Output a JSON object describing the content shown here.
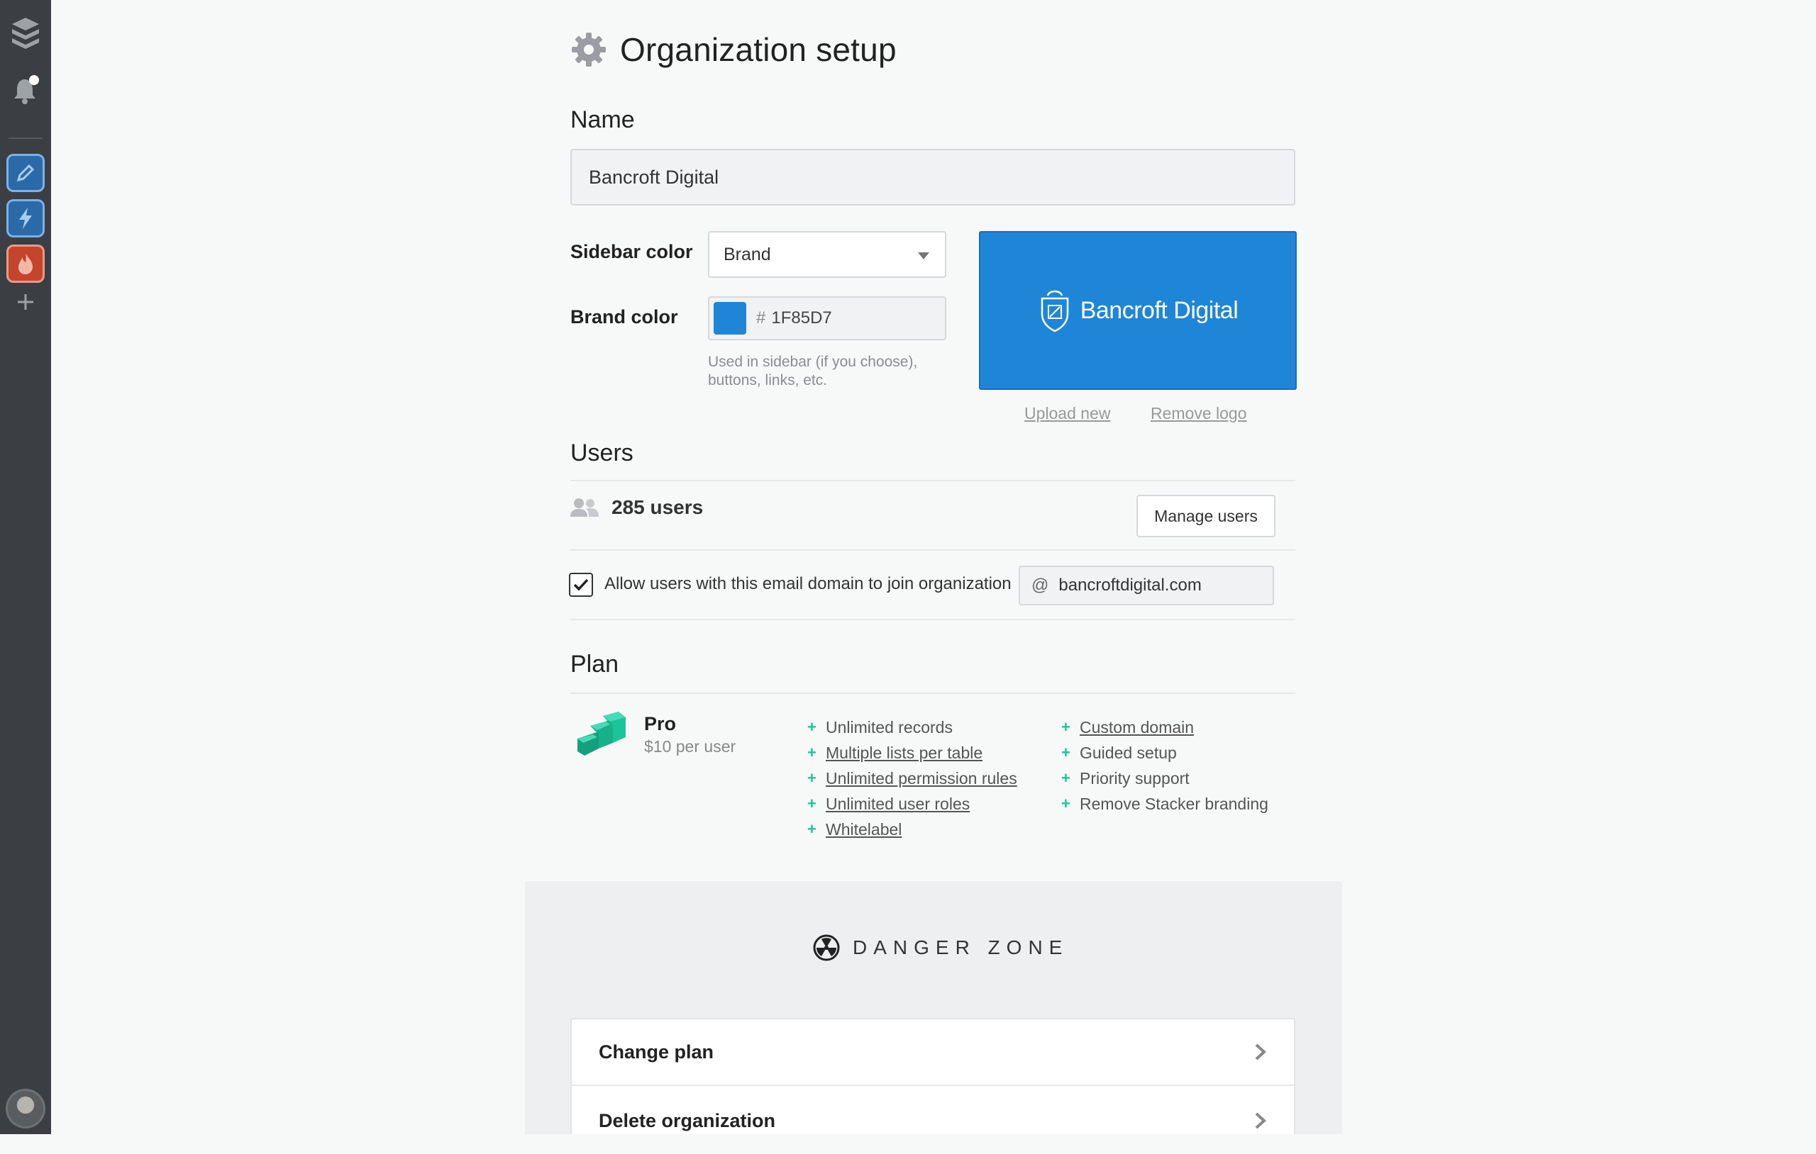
{
  "colors": {
    "rail": "#3b3f43",
    "brand": "#1F85D7",
    "plan_accent": "#1bc49a"
  },
  "rail": {
    "icons": [
      "stacker-logo-icon",
      "notifications-bell-icon",
      "pencil-app-icon",
      "lightning-app-icon",
      "flame-app-icon",
      "add-app-icon",
      "user-avatar"
    ]
  },
  "page": {
    "title": "Organization setup",
    "icon": "gear-icon"
  },
  "name_section": {
    "heading": "Name",
    "value": "Bancroft Digital"
  },
  "appearance": {
    "sidebar_color_label": "Sidebar color",
    "sidebar_color_value": "Brand",
    "brand_color_label": "Brand color",
    "brand_color_hash": "#",
    "brand_color_value": "1F85D7",
    "hint": "Used in sidebar (if you choose), buttons, links, etc.",
    "logo_text": "Bancroft Digital",
    "upload_label": "Upload new",
    "remove_label": "Remove logo"
  },
  "users": {
    "heading": "Users",
    "count_label": "285 users",
    "manage_label": "Manage users",
    "allow_domain_label": "Allow users with this email domain to join organization",
    "allow_domain_checked": true,
    "domain_at": "@",
    "domain_value": "bancroftdigital.com"
  },
  "plan": {
    "heading": "Plan",
    "name": "Pro",
    "price": "$10 per user",
    "features_left": [
      "Unlimited records",
      "Multiple lists per table",
      "Unlimited permission rules",
      "Unlimited user roles",
      "Whitelabel"
    ],
    "features_right": [
      "Custom domain",
      "Guided setup",
      "Priority support",
      "Remove Stacker branding"
    ]
  },
  "danger": {
    "title": "DANGER ZONE",
    "change_plan": "Change plan",
    "delete_org": "Delete organization"
  }
}
